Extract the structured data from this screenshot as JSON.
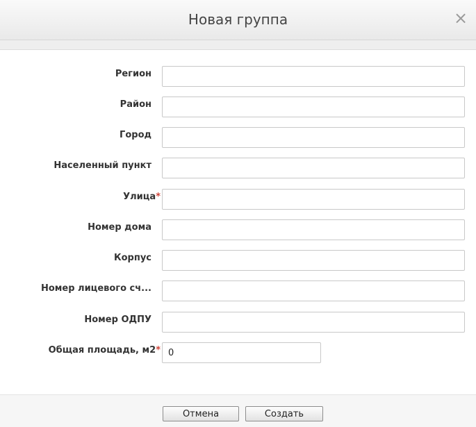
{
  "dialog": {
    "title": "Новая группа",
    "close_glyph": "×"
  },
  "form": {
    "fields": [
      {
        "label": "Регион",
        "value": "",
        "required": false
      },
      {
        "label": "Район",
        "value": "",
        "required": false
      },
      {
        "label": "Город",
        "value": "",
        "required": false
      },
      {
        "label": "Населенный пункт",
        "value": "",
        "required": false
      },
      {
        "label": "Улица",
        "value": "",
        "required": true
      },
      {
        "label": "Номер дома",
        "value": "",
        "required": false
      },
      {
        "label": "Корпус",
        "value": "",
        "required": false
      },
      {
        "label": "Номер лицевого сч...",
        "value": "",
        "required": false
      },
      {
        "label": "Номер ОДПУ",
        "value": "",
        "required": false
      },
      {
        "label": "Общая площадь, м2",
        "value": "0",
        "required": true
      }
    ],
    "required_mark": "*"
  },
  "footer": {
    "cancel_label": "Отмена",
    "create_label": "Создать"
  },
  "colors": {
    "required_star": "#d0453b",
    "title_text": "#444444"
  }
}
